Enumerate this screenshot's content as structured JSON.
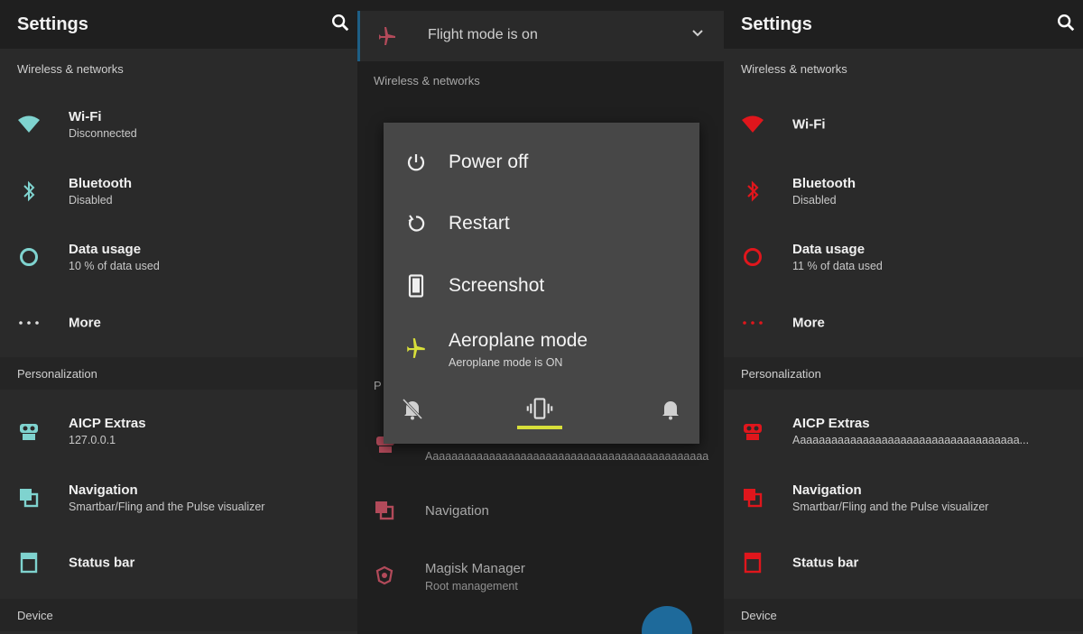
{
  "left_panel": {
    "title": "Settings",
    "section_wireless": "Wireless & networks",
    "wifi": {
      "label": "Wi-Fi",
      "status": "Disconnected"
    },
    "bluetooth": {
      "label": "Bluetooth",
      "status": "Disabled"
    },
    "data_usage": {
      "label": "Data usage",
      "status": "10 % of data used"
    },
    "more": {
      "label": "More"
    },
    "section_personalization": "Personalization",
    "aicp": {
      "label": "AICP Extras",
      "status": "127.0.0.1"
    },
    "navigation": {
      "label": "Navigation",
      "status": "Smartbar/Fling and the Pulse visualizer"
    },
    "status_bar": {
      "label": "Status bar"
    },
    "section_device": "Device",
    "accent": "#7fd3cf"
  },
  "middle_panel": {
    "flight_banner": "Flight mode is on",
    "section_wireless": "Wireless & networks",
    "section_personalization_partial": "P",
    "aicp_partial": "Aaaaaaaaaaaaaaaaaaaaaaaaaaaaaaaaaaaaaaaaaaaaa",
    "navigation": "Navigation",
    "magisk": {
      "label": "Magisk Manager",
      "status": "Root management"
    },
    "accent": "#b24a5a",
    "power_menu": {
      "power_off": "Power off",
      "restart": "Restart",
      "screenshot": "Screenshot",
      "aeroplane": {
        "label": "Aeroplane mode",
        "status": "Aeroplane mode is ON"
      },
      "active_accent": "#d8df3a"
    }
  },
  "right_panel": {
    "title": "Settings",
    "section_wireless": "Wireless & networks",
    "wifi": {
      "label": "Wi-Fi"
    },
    "bluetooth": {
      "label": "Bluetooth",
      "status": "Disabled"
    },
    "data_usage": {
      "label": "Data usage",
      "status": "11 % of data used"
    },
    "more": {
      "label": "More"
    },
    "section_personalization": "Personalization",
    "aicp": {
      "label": "AICP Extras",
      "status": "Aaaaaaaaaaaaaaaaaaaaaaaaaaaaaaaaaaaa..."
    },
    "navigation": {
      "label": "Navigation",
      "status": "Smartbar/Fling and the Pulse visualizer"
    },
    "status_bar": {
      "label": "Status bar"
    },
    "section_device": "Device",
    "accent": "#e0161c"
  }
}
